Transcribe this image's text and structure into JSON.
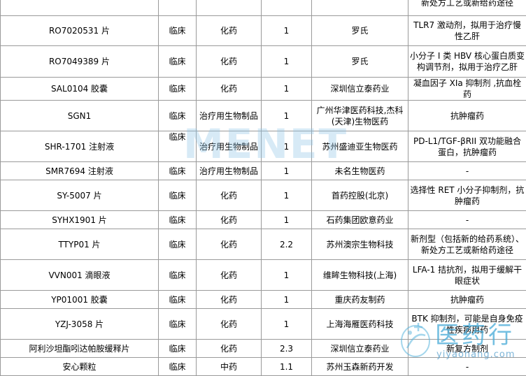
{
  "rows": [
    {
      "name": "",
      "stage": "",
      "category": "",
      "class": "",
      "company": "",
      "note": "新处方工艺或新给药途径",
      "note_align": "left"
    },
    {
      "name": "RO7020531 片",
      "stage": "临床",
      "category": "化药",
      "class": "1",
      "company": "罗氏",
      "note": "TLR7 激动剂，拟用于治疗慢性乙肝",
      "note_align": "left"
    },
    {
      "name": "RO7049389 片",
      "stage": "临床",
      "category": "化药",
      "class": "1",
      "company": "罗氏",
      "note": "小分子 I 类 HBV 核心蛋白质变构调节剂，拟用于治疗乙肝",
      "note_align": "left"
    },
    {
      "name": "SAL0104 胶囊",
      "stage": "临床",
      "category": "化药",
      "class": "1",
      "company": "深圳信立泰药业",
      "note": "凝血因子 XIa 抑制剂 ,抗血栓药",
      "note_align": "left"
    },
    {
      "name": "SGN1",
      "stage": "临床",
      "category": "治疗用生物制品",
      "class": "1",
      "company": "广州华津医药科技,杰科(天津)生物医药",
      "note": "抗肿瘤药",
      "note_align": "center"
    },
    {
      "name": "SHR-1701 注射液",
      "stage": "临床",
      "category": "治疗用生物制品",
      "class": "1",
      "company": "苏州盛迪亚生物医药",
      "note": "PD-L1/TGF-βRII 双功能融合蛋白，抗肿瘤药",
      "note_align": "center"
    },
    {
      "name": "SMR7694 注射液",
      "stage": "临床",
      "category": "治疗用生物制品",
      "class": "1",
      "company": "未名生物医药",
      "note": "-",
      "note_align": "center"
    },
    {
      "name": "SY-5007 片",
      "stage": "临床",
      "category": "化药",
      "class": "1",
      "company": "首药控股(北京)",
      "note": "选择性 RET 小分子抑制剂，抗肿瘤药",
      "note_align": "center"
    },
    {
      "name": "SYHX1901 片",
      "stage": "临床",
      "category": "化药",
      "class": "1",
      "company": "石药集团欧意药业",
      "note": "-",
      "note_align": "center"
    },
    {
      "name": "TTYP01 片",
      "stage": "临床",
      "category": "化药",
      "class": "2.2",
      "company": "苏州澳宗生物科技",
      "note": "新剂型（包括新的给药系统）、新处方工艺或新给药途径",
      "note_align": "left"
    },
    {
      "name": "VVN001 滴眼液",
      "stage": "临床",
      "category": "化药",
      "class": "1",
      "company": "维眸生物科技(上海)",
      "note": "LFA-1 拮抗剂，拟用于缓解干眼症状",
      "note_align": "center"
    },
    {
      "name": "YP01001 胶囊",
      "stage": "临床",
      "category": "化药",
      "class": "1",
      "company": "重庆药友制药",
      "note": "抗肿瘤药",
      "note_align": "center"
    },
    {
      "name": "YZJ-3058 片",
      "stage": "临床",
      "category": "化药",
      "class": "1",
      "company": "上海海雁医药科技",
      "note": "BTK 抑制剂，可能是自身免疫性疾病用药",
      "note_align": "center"
    },
    {
      "name": "阿利沙坦酯吲达帕胺缓释片",
      "stage": "临床",
      "category": "化药",
      "class": "2.3",
      "company": "深圳信立泰药业",
      "note": "新复方制剂",
      "note_align": "center"
    },
    {
      "name": "安心颗粒",
      "stage": "临床",
      "category": "中药",
      "class": "1.1",
      "company": "苏州玉森新药开发",
      "note": "-",
      "note_align": "center"
    }
  ],
  "watermark": {
    "text": "MENET"
  },
  "logo": {
    "text": "医药行",
    "sub": "yiyaohang.com"
  }
}
